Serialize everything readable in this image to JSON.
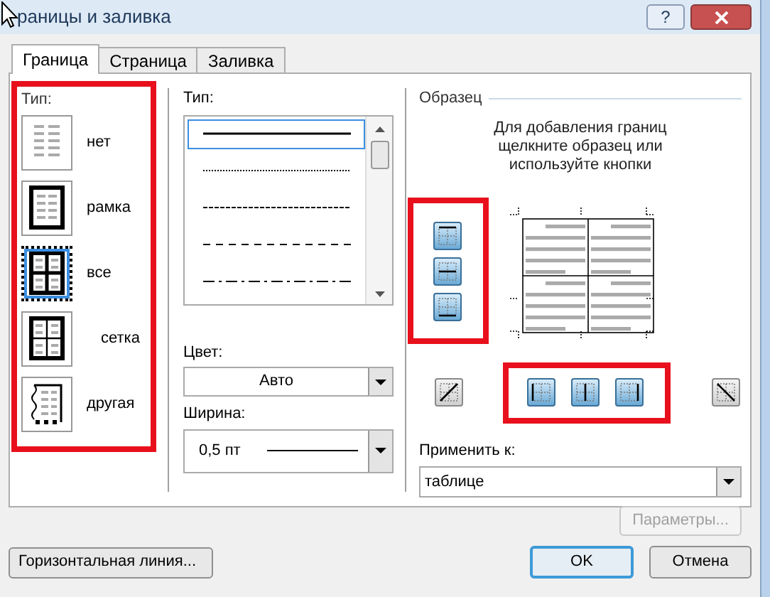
{
  "window": {
    "title": "раницы и заливка",
    "help": "?"
  },
  "tabs": [
    {
      "label": "Граница",
      "selected": true
    },
    {
      "label": "Страница",
      "selected": false
    },
    {
      "label": "Заливка",
      "selected": false
    }
  ],
  "setting": {
    "label": "Тип:",
    "items": [
      {
        "label": "нет",
        "kind": "none",
        "selected": false
      },
      {
        "label": "рамка",
        "kind": "box",
        "selected": false
      },
      {
        "label": "все",
        "kind": "all",
        "selected": true
      },
      {
        "label": "сетка",
        "kind": "grid",
        "selected": false
      },
      {
        "label": "другая",
        "kind": "custom",
        "selected": false
      }
    ]
  },
  "style": {
    "label": "Тип:",
    "lines": [
      {
        "kind": "solid",
        "selected": true
      },
      {
        "kind": "dotted",
        "selected": false
      },
      {
        "kind": "fine-dash",
        "selected": false
      },
      {
        "kind": "dash",
        "selected": false
      },
      {
        "kind": "dash-dot",
        "selected": false
      }
    ]
  },
  "color": {
    "label": "Цвет:",
    "value": "Авто"
  },
  "width": {
    "label": "Ширина:",
    "value": "0,5 пт"
  },
  "preview": {
    "label": "Образец",
    "hint": "Для добавления границ щелкните образец или используйте кнопки",
    "side_buttons": [
      {
        "kind": "top",
        "on": true
      },
      {
        "kind": "inside-h",
        "on": true
      },
      {
        "kind": "bottom",
        "on": true
      }
    ],
    "bottom_buttons": [
      {
        "kind": "diag-up",
        "on": false
      },
      {
        "kind": "left",
        "on": true
      },
      {
        "kind": "inside-v",
        "on": true
      },
      {
        "kind": "right",
        "on": true
      },
      {
        "kind": "diag-down",
        "on": false
      }
    ]
  },
  "apply_to": {
    "label": "Применить к:",
    "value": "таблице"
  },
  "options_button": {
    "label": "Параметры...",
    "disabled": true
  },
  "horizontal_line_button": "Горизонтальная линия...",
  "ok_button": "OK",
  "cancel_button": "Отмена"
}
